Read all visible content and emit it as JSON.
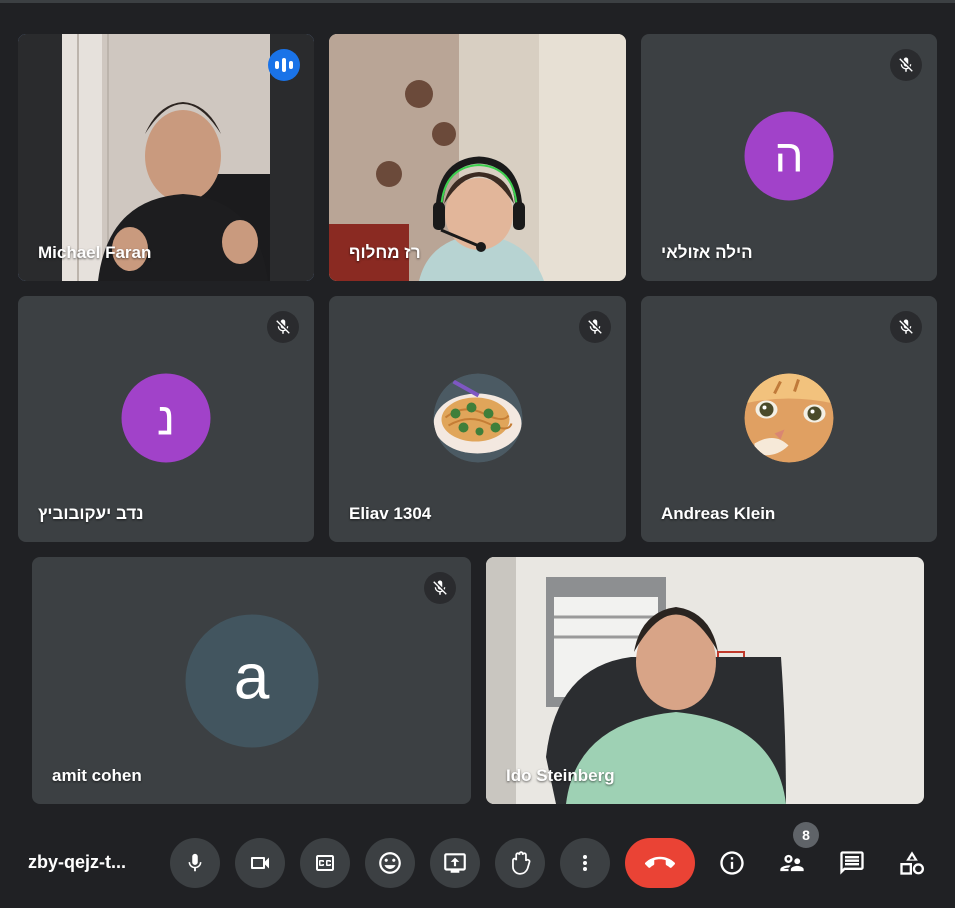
{
  "participants": [
    {
      "name": "Michael Faran",
      "speaking": true,
      "type": "video"
    },
    {
      "name": "רז מחלוף",
      "type": "video"
    },
    {
      "name": "הילה אזולאי",
      "muted": true,
      "initial": "ה",
      "avatar_color": "#a142c9"
    },
    {
      "name": "נדב יעקובוביץ",
      "muted": true,
      "initial": "נ",
      "avatar_color": "#a142c9"
    },
    {
      "name": "Eliav 1304",
      "muted": true,
      "avatar_image": "pasta-plate"
    },
    {
      "name": "Andreas Klein",
      "muted": true,
      "avatar_image": "orange-kitten"
    },
    {
      "name": "amit cohen",
      "muted": true,
      "initial": "a",
      "avatar_color": "#42555f"
    },
    {
      "name": "Ido Steinberg",
      "type": "video"
    }
  ],
  "meeting": {
    "code": "zby-qejz-t..."
  },
  "toolbar": {
    "buttons": [
      "microphone",
      "camera",
      "captions",
      "reactions",
      "present-screen",
      "raise-hand",
      "more-options",
      "leave-call"
    ],
    "right_icons": [
      "meeting-info",
      "people",
      "chat",
      "activities"
    ],
    "people_count": "8"
  },
  "colors": {
    "background": "#202124",
    "tile": "#3c4043",
    "end_call": "#ea4335",
    "speaking": "#1a73e8",
    "active_outline": "#8ab4f8"
  }
}
